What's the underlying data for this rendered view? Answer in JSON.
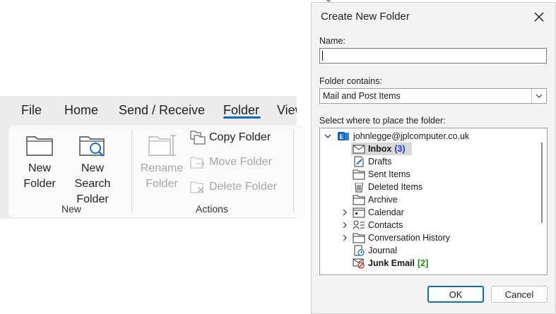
{
  "ribbon": {
    "tabs": [
      "File",
      "Home",
      "Send / Receive",
      "Folder",
      "View"
    ],
    "active_tab": "Folder",
    "new_folder_label": [
      "New",
      "Folder"
    ],
    "new_search_folder_label": [
      "New Search",
      "Folder"
    ],
    "rename_folder_label": [
      "Rename",
      "Folder"
    ],
    "copy_folder_label": "Copy Folder",
    "move_folder_label": "Move Folder",
    "delete_folder_label": "Delete Folder",
    "group_new": "New",
    "group_actions": "Actions"
  },
  "dialog": {
    "title": "Create New Folder",
    "name_label": "Name:",
    "name_value": "",
    "folder_contains_label": "Folder contains:",
    "folder_contains_value": "Mail and Post Items",
    "place_label": "Select where to place the folder:",
    "account": "johnlegge@jplcomputer.co.uk",
    "folders": [
      {
        "name": "Inbox",
        "count": "(3)",
        "icon": "inbox-icon",
        "bold": true,
        "selected": true
      },
      {
        "name": "Drafts",
        "count": "",
        "icon": "drafts-icon"
      },
      {
        "name": "Sent Items",
        "count": "",
        "icon": "folder-icon"
      },
      {
        "name": "Deleted Items",
        "count": "",
        "icon": "trash-icon"
      },
      {
        "name": "Archive",
        "count": "",
        "icon": "folder-icon"
      },
      {
        "name": "Calendar",
        "count": "",
        "icon": "calendar-icon",
        "expandable": true
      },
      {
        "name": "Contacts",
        "count": "",
        "icon": "contacts-icon",
        "expandable": true
      },
      {
        "name": "Conversation History",
        "count": "",
        "icon": "folder-icon",
        "expandable": true
      },
      {
        "name": "Journal",
        "count": "",
        "icon": "journal-icon"
      },
      {
        "name": "Junk Email",
        "count": "[2]",
        "icon": "junk-icon",
        "bold": true
      }
    ],
    "ok_label": "OK",
    "cancel_label": "Cancel"
  },
  "colors": {
    "accent": "#0f6cbd",
    "unread": "#1c3fd1",
    "junk_count": "#168a16"
  }
}
